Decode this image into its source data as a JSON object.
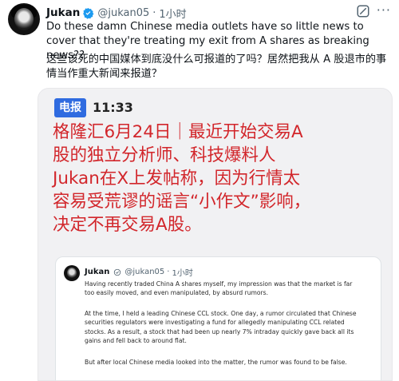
{
  "tweet": {
    "author": "Jukan",
    "handle": "@jukan05",
    "separator": "·",
    "time": "1小时",
    "more_label": "···",
    "text_en": "Do these damn Chinese media outlets have so little news to cover that they're treating my exit from A shares as breaking news??",
    "text_zh": "这些该死的中国媒体到底没什么可报道的了吗？居然把我从 A 股退市的事情当作重大新闻来报道？"
  },
  "media": {
    "badge": "电报",
    "time": "11:33",
    "headline_lines": [
      "格隆汇6月24日｜最近开始交易A",
      "股的独立分析师、科技爆料人",
      "Jukan在X上发帖称，因为行情太",
      "容易受荒谬的谣言“小作文”影响，",
      "决定不再交易A股。"
    ],
    "quote": {
      "author": "Jukan",
      "handle": "@jukan05",
      "separator": "·",
      "time": "1小时",
      "p1": "Having recently traded China A shares myself, my impression was that the market is far too easily moved, and even manipulated, by absurd rumors.",
      "p2": "At the time, I held a leading Chinese CCL stock. One day, a rumor circulated that Chinese securities regulators were investigating a fund for allegedly manipulating CCL related stocks. As a result, a stock that had been up nearly 7% intraday quickly gave back all its gains and fell back to around flat.",
      "p3": "But after local Chinese media looked into the matter, the rumor was found to be false."
    }
  },
  "colors": {
    "verified": "#1d9bf0",
    "badge": "#2f6be0",
    "headline": "#d2262b"
  },
  "icons": {
    "verified": "verified-badge-icon",
    "grok": "grok-icon",
    "more": "more-icon"
  }
}
